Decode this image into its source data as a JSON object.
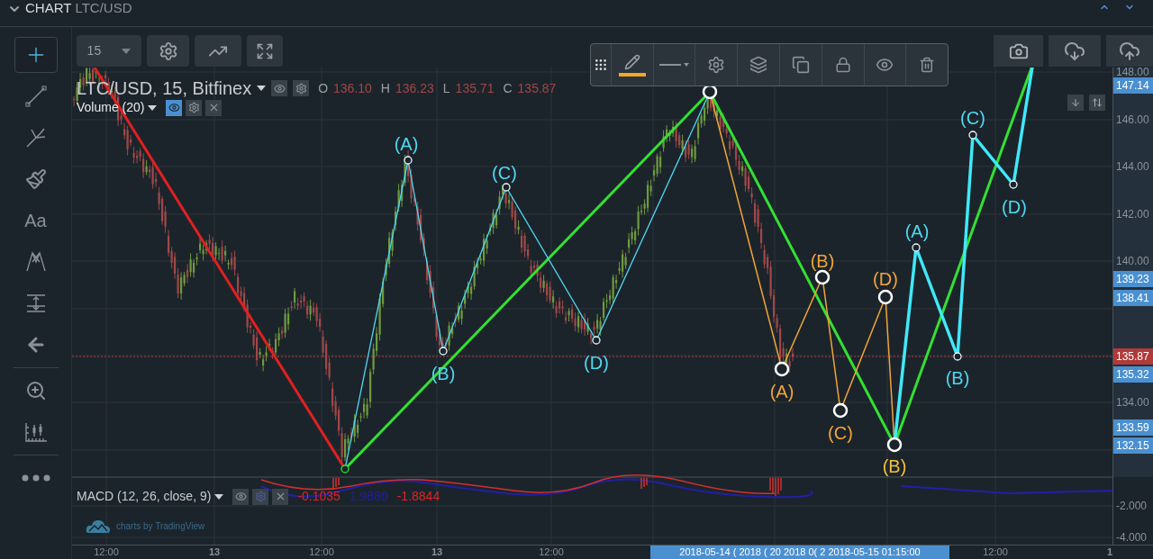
{
  "header": {
    "title": "CHART",
    "symbol": "LTC/USD"
  },
  "tools": [
    {
      "kind": "crosshair",
      "selected": true
    },
    {
      "kind": "trend-line",
      "selected": false
    },
    {
      "kind": "pitchfork",
      "selected": false
    },
    {
      "kind": "brush",
      "selected": false
    },
    {
      "kind": "text",
      "label": "Aa",
      "selected": false
    },
    {
      "kind": "pattern",
      "selected": false
    },
    {
      "kind": "range",
      "selected": false
    },
    {
      "kind": "arrow",
      "selected": false
    },
    {
      "kind": "zoom",
      "selected": false
    },
    {
      "kind": "measure",
      "selected": false
    },
    {
      "kind": "more",
      "selected": false
    }
  ],
  "toolbar": {
    "interval": "15"
  },
  "drawing_toolbar": {
    "color": "#f5a623"
  },
  "legend": {
    "title": "LTC/USD, 15, Bitfinex",
    "ohlc": [
      {
        "label": "O",
        "value": "136.10"
      },
      {
        "label": "H",
        "value": "136.23"
      },
      {
        "label": "L",
        "value": "135.71"
      },
      {
        "label": "C",
        "value": "135.87"
      }
    ]
  },
  "volume": {
    "title": "Volume (20)"
  },
  "macd": {
    "title": "MACD (12, 26, close, 9)",
    "values": [
      {
        "value": "-0.1035",
        "color": "#e02424"
      },
      {
        "value": "1.9880",
        "color": "#1d1fa0"
      },
      {
        "value": "-1.8844",
        "color": "#e02424"
      }
    ]
  },
  "attribution": "charts by TradingView",
  "wave_labels": [
    {
      "text": "(A)",
      "color": "#4fd8f0"
    },
    {
      "text": "(B)",
      "color": "#4fd8f0"
    },
    {
      "text": "(C)",
      "color": "#4fd8f0"
    },
    {
      "text": "(D)",
      "color": "#4fd8f0"
    },
    {
      "text": "(A)",
      "color": "#f0a53a"
    },
    {
      "text": "(B)",
      "color": "#f0a53a"
    },
    {
      "text": "(C)",
      "color": "#f0a53a"
    },
    {
      "text": "(D)",
      "color": "#f0a53a"
    },
    {
      "text": "(B)",
      "color": "#f0c040"
    },
    {
      "text": "(A)",
      "color": "#4fd8f0"
    },
    {
      "text": "(B)",
      "color": "#4fd8f0"
    },
    {
      "text": "(C)",
      "color": "#4fd8f0"
    },
    {
      "text": "(D)",
      "color": "#4fd8f0"
    }
  ],
  "price_axis": {
    "ticks": [
      "148.00",
      "146.00",
      "144.00",
      "142.00",
      "140.00",
      "134.00",
      "-2.000",
      "-4.000"
    ],
    "markers": [
      {
        "value": "147.14",
        "color": "#4a90d0"
      },
      {
        "value": "139.23",
        "color": "#4a90d0"
      },
      {
        "value": "138.41",
        "color": "#4a90d0"
      },
      {
        "value": "135.87",
        "color": "#b03a3a"
      },
      {
        "value": "135.32",
        "color": "#4a90d0"
      },
      {
        "value": "133.59",
        "color": "#4a90d0"
      },
      {
        "value": "132.15",
        "color": "#4a90d0"
      }
    ]
  },
  "time_axis": {
    "labels": [
      {
        "text": "12:00",
        "kind": "time"
      },
      {
        "text": "13",
        "kind": "day"
      },
      {
        "text": "12:00",
        "kind": "time"
      },
      {
        "text": "13",
        "kind": "day"
      },
      {
        "text": "12:00",
        "kind": "time"
      },
      {
        "text": "12:00",
        "kind": "time"
      },
      {
        "text": "1",
        "kind": "day"
      }
    ],
    "crosshair_label": "2018-05-14 ( 2018 ( 20 2018 0( 2 2018-05-15 01:15:00"
  }
}
